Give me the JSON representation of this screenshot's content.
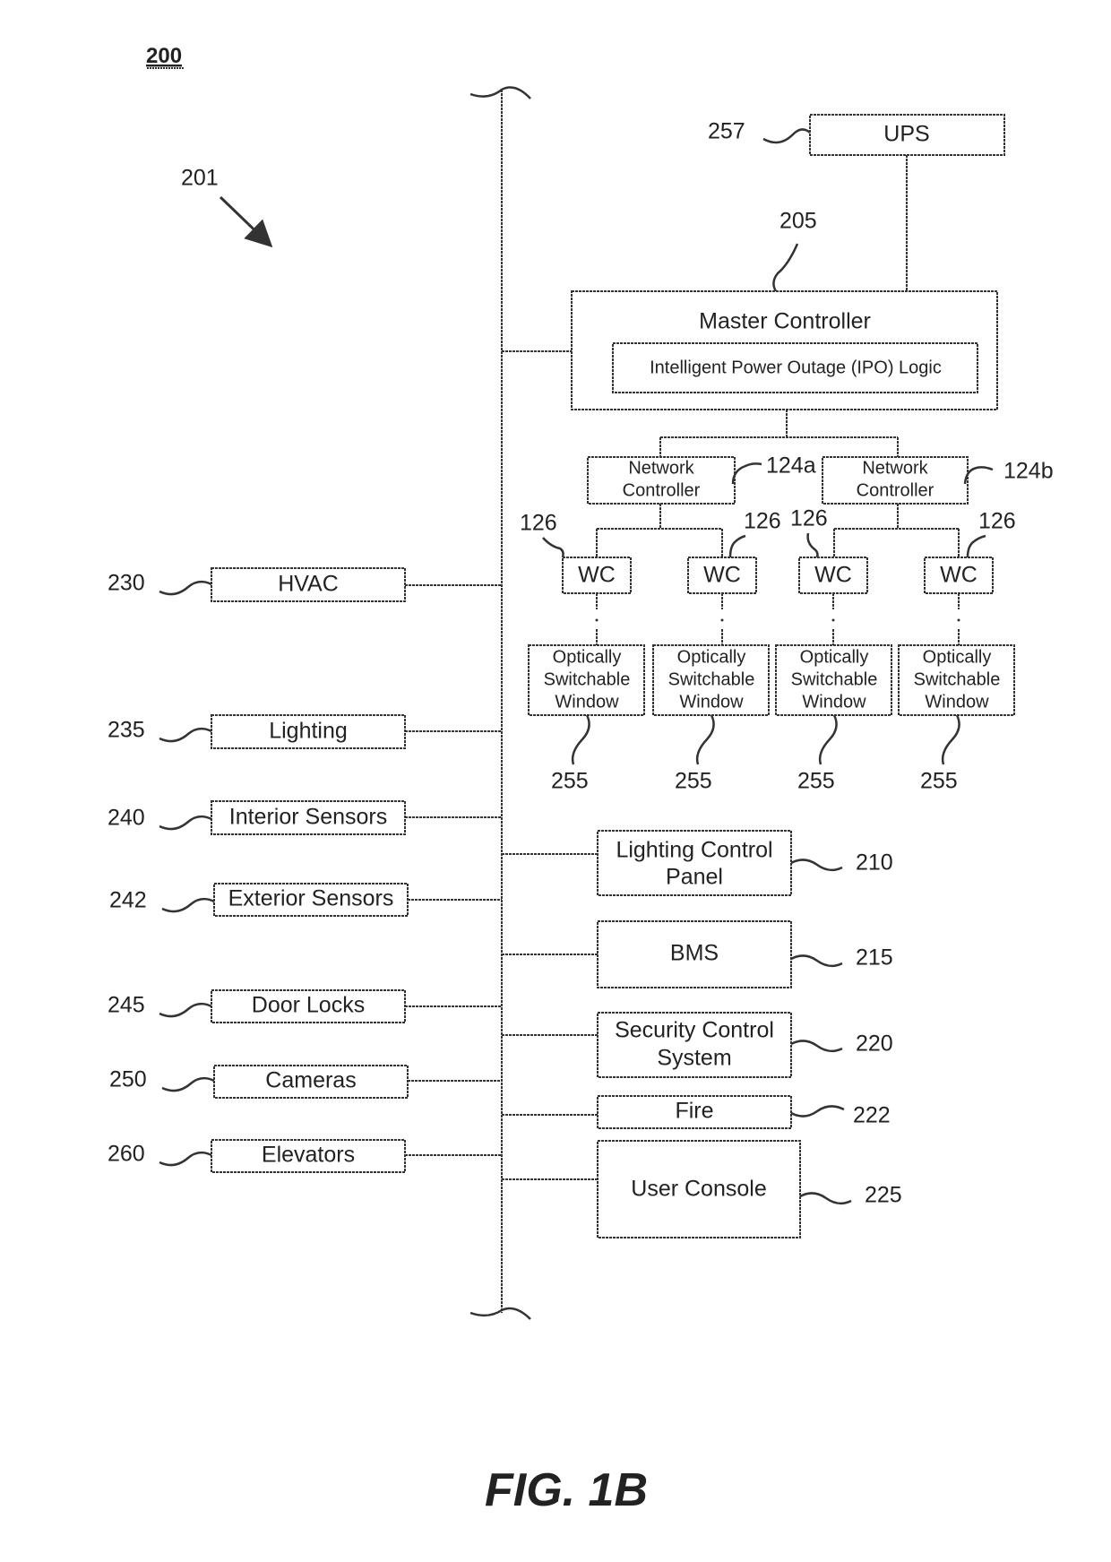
{
  "figure": {
    "number_label": "200",
    "system_ref": "201",
    "caption": "FIG. 1B"
  },
  "ups": {
    "label": "UPS",
    "ref": "257"
  },
  "master_controller": {
    "label": "Master Controller",
    "ref": "205",
    "logic_label": "Intelligent Power Outage (IPO) Logic"
  },
  "network_controllers": [
    {
      "line1": "Network",
      "line2": "Controller",
      "ref": "124a"
    },
    {
      "line1": "Network",
      "line2": "Controller",
      "ref": "124b"
    }
  ],
  "window_controllers": [
    {
      "label": "WC",
      "ref": "126"
    },
    {
      "label": "WC",
      "ref": "126"
    },
    {
      "label": "WC",
      "ref": "126"
    },
    {
      "label": "WC",
      "ref": "126"
    }
  ],
  "windows": [
    {
      "line1": "Optically",
      "line2": "Switchable",
      "line3": "Window",
      "ref": "255"
    },
    {
      "line1": "Optically",
      "line2": "Switchable",
      "line3": "Window",
      "ref": "255"
    },
    {
      "line1": "Optically",
      "line2": "Switchable",
      "line3": "Window",
      "ref": "255"
    },
    {
      "line1": "Optically",
      "line2": "Switchable",
      "line3": "Window",
      "ref": "255"
    }
  ],
  "left_systems": [
    {
      "label": "HVAC",
      "ref": "230"
    },
    {
      "label": "Lighting",
      "ref": "235"
    },
    {
      "label": "Interior Sensors",
      "ref": "240"
    },
    {
      "label": "Exterior Sensors",
      "ref": "242"
    },
    {
      "label": "Door Locks",
      "ref": "245"
    },
    {
      "label": "Cameras",
      "ref": "250"
    },
    {
      "label": "Elevators",
      "ref": "260"
    }
  ],
  "right_systems": [
    {
      "line1": "Lighting Control",
      "line2": "Panel",
      "ref": "210"
    },
    {
      "line1": "BMS",
      "line2": "",
      "ref": "215"
    },
    {
      "line1": "Security Control",
      "line2": "System",
      "ref": "220"
    },
    {
      "line1": "Fire",
      "line2": "",
      "ref": "222"
    },
    {
      "line1": "User Console",
      "line2": "",
      "ref": "225"
    }
  ]
}
